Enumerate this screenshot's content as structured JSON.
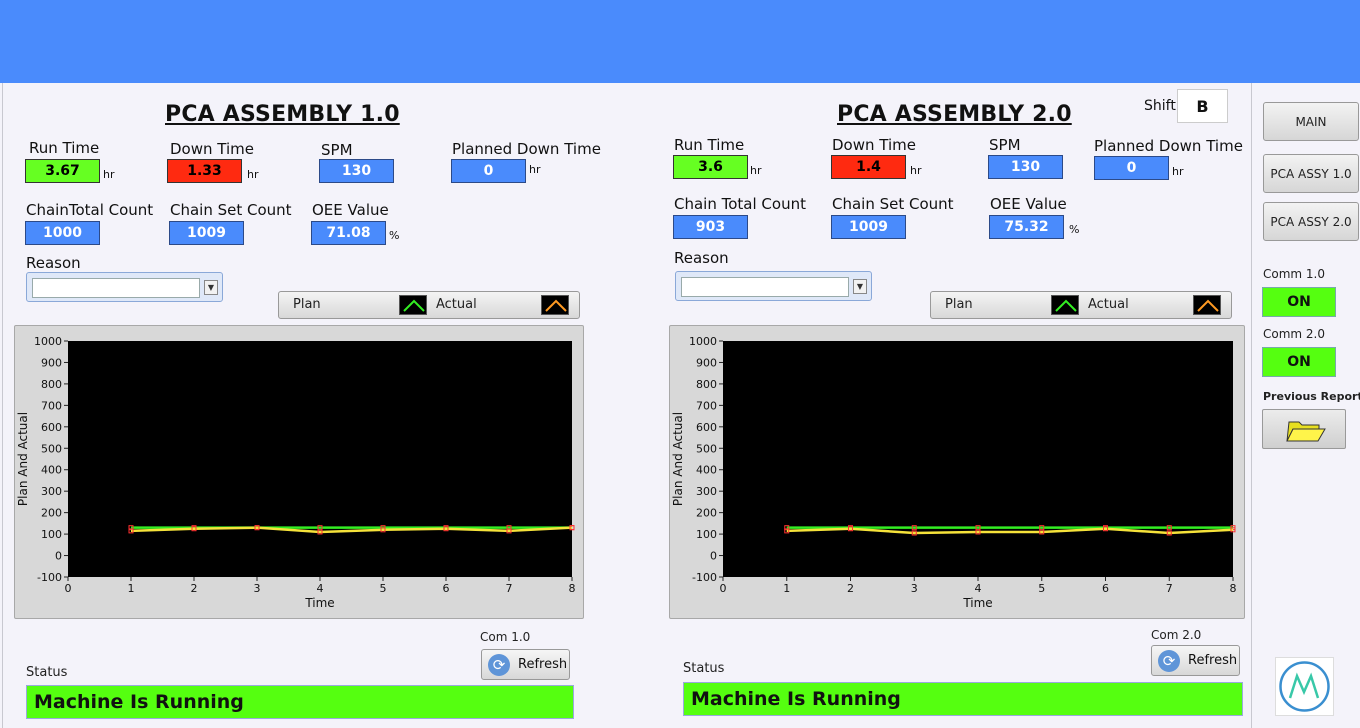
{
  "shift": {
    "label": "Shift",
    "value": "B"
  },
  "panels": [
    {
      "title": "PCA ASSEMBLY 1.0",
      "run_time": {
        "label": "Run Time",
        "value": "3.67",
        "unit": "hr"
      },
      "down_time": {
        "label": "Down Time",
        "value": "1.33",
        "unit": "hr"
      },
      "spm": {
        "label": "SPM",
        "value": "130"
      },
      "planned_down_time": {
        "label": "Planned Down Time",
        "value": "0",
        "unit": "hr"
      },
      "chain_total_count": {
        "label": "ChainTotal Count",
        "value": "1000"
      },
      "chain_set_count": {
        "label": "Chain Set Count",
        "value": "1009"
      },
      "oee_value": {
        "label": "OEE Value",
        "value": "71.08",
        "unit": "%"
      },
      "reason": {
        "label": "Reason",
        "value": ""
      },
      "legend": {
        "plan": "Plan",
        "actual": "Actual"
      },
      "com_label": "Com 1.0",
      "refresh_label": "Refresh",
      "status": {
        "label": "Status",
        "value": "Machine Is Running"
      }
    },
    {
      "title": "PCA ASSEMBLY 2.0",
      "run_time": {
        "label": "Run Time",
        "value": "3.6",
        "unit": "hr"
      },
      "down_time": {
        "label": "Down Time",
        "value": "1.4",
        "unit": "hr"
      },
      "spm": {
        "label": "SPM",
        "value": "130"
      },
      "planned_down_time": {
        "label": "Planned Down Time",
        "value": "0",
        "unit": "hr"
      },
      "chain_total_count": {
        "label": "Chain Total Count",
        "value": "903"
      },
      "chain_set_count": {
        "label": "Chain Set Count",
        "value": "1009"
      },
      "oee_value": {
        "label": "OEE Value",
        "value": "75.32",
        "unit": "%"
      },
      "reason": {
        "label": "Reason",
        "value": ""
      },
      "legend": {
        "plan": "Plan",
        "actual": "Actual"
      },
      "com_label": "Com 2.0",
      "refresh_label": "Refresh",
      "status": {
        "label": "Status",
        "value": "Machine Is Running"
      }
    }
  ],
  "sidebar": {
    "main_label": "MAIN",
    "pca1_label": "PCA ASSY 1.0",
    "pca2_label": "PCA ASSY 2.0",
    "comm1": {
      "label": "Comm 1.0",
      "value": "ON"
    },
    "comm2": {
      "label": "Comm 2.0",
      "value": "ON"
    },
    "previous_report_label": "Previous Report",
    "folder_icon": "folder-open-icon",
    "logo_icon": "mountain-logo-icon"
  },
  "chart_data": [
    {
      "type": "line",
      "xlabel": "Time",
      "ylabel": "Plan And Actual",
      "xlim": [
        0,
        8
      ],
      "ylim": [
        -100,
        1000
      ],
      "xticks": [
        0,
        1,
        2,
        3,
        4,
        5,
        6,
        7,
        8
      ],
      "yticks": [
        -100,
        0,
        100,
        200,
        300,
        400,
        500,
        600,
        700,
        800,
        900,
        1000
      ],
      "grid": false,
      "series": [
        {
          "name": "Plan",
          "color": "#33ee22",
          "x": [
            1,
            2,
            3,
            4,
            5,
            6,
            7,
            8
          ],
          "values": [
            130,
            130,
            130,
            130,
            130,
            130,
            130,
            130
          ]
        },
        {
          "name": "Actual",
          "color": "#f5e23a",
          "x": [
            1,
            2,
            3,
            4,
            5,
            6,
            7,
            8
          ],
          "values": [
            115,
            125,
            130,
            110,
            120,
            125,
            115,
            130
          ]
        }
      ]
    },
    {
      "type": "line",
      "xlabel": "Time",
      "ylabel": "Plan And Actual",
      "xlim": [
        0,
        8
      ],
      "ylim": [
        -100,
        1000
      ],
      "xticks": [
        0,
        1,
        2,
        3,
        4,
        5,
        6,
        7,
        8
      ],
      "yticks": [
        -100,
        0,
        100,
        200,
        300,
        400,
        500,
        600,
        700,
        800,
        900,
        1000
      ],
      "grid": false,
      "series": [
        {
          "name": "Plan",
          "color": "#33ee22",
          "x": [
            1,
            2,
            3,
            4,
            5,
            6,
            7,
            8
          ],
          "values": [
            130,
            130,
            130,
            130,
            130,
            130,
            130,
            130
          ]
        },
        {
          "name": "Actual",
          "color": "#f5e23a",
          "x": [
            1,
            2,
            3,
            4,
            5,
            6,
            7,
            8
          ],
          "values": [
            115,
            125,
            105,
            110,
            110,
            125,
            105,
            120
          ]
        }
      ]
    }
  ]
}
